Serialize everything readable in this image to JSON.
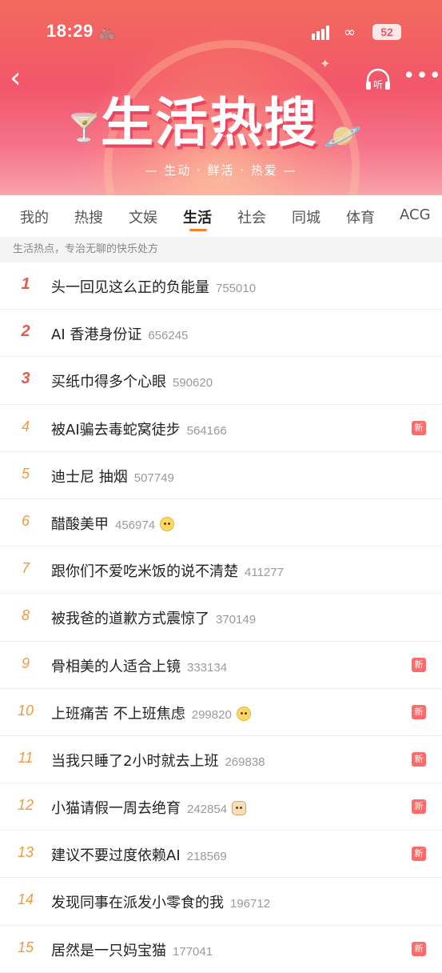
{
  "status_bar": {
    "time": "18:29",
    "battery": "52"
  },
  "header": {
    "title": "生活热搜",
    "subtitle": "— 生动 · 鲜活 · 热爱 —",
    "listen_label": "听"
  },
  "tabs": [
    "我的",
    "热搜",
    "文娱",
    "生活",
    "社会",
    "同城",
    "体育",
    "ACG"
  ],
  "active_tab": "生活",
  "notice": "生活热点，专治无聊的快乐处方",
  "badge_label": "新",
  "colors": {
    "accent": "#ff7a2b",
    "top_rank": "#e45a4f",
    "rank": "#f09a3d",
    "new_badge": "#ff6b6b"
  },
  "items": [
    {
      "rank": "1",
      "title": "头一回见这么正的负能量",
      "count": "755010",
      "icon": "",
      "new": false
    },
    {
      "rank": "2",
      "title": "AI 香港身份证",
      "count": "656245",
      "icon": "",
      "new": false
    },
    {
      "rank": "3",
      "title": "买纸巾得多个心眼",
      "count": "590620",
      "icon": "",
      "new": false
    },
    {
      "rank": "4",
      "title": "被AI骗去毒蛇窝徒步",
      "count": "564166",
      "icon": "",
      "new": true
    },
    {
      "rank": "5",
      "title": "迪士尼 抽烟",
      "count": "507749",
      "icon": "",
      "new": false
    },
    {
      "rank": "6",
      "title": "醋酸美甲",
      "count": "456974",
      "icon": "smiling-emoji-icon",
      "new": false
    },
    {
      "rank": "7",
      "title": "跟你们不爱吃米饭的说不清楚",
      "count": "411277",
      "icon": "",
      "new": false
    },
    {
      "rank": "8",
      "title": "被我爸的道歉方式震惊了",
      "count": "370149",
      "icon": "",
      "new": false
    },
    {
      "rank": "9",
      "title": "骨相美的人适合上镜",
      "count": "333134",
      "icon": "",
      "new": true
    },
    {
      "rank": "10",
      "title": "上班痛苦 不上班焦虑",
      "count": "299820",
      "icon": "face-emoji-icon",
      "new": true
    },
    {
      "rank": "11",
      "title": "当我只睡了2小时就去上班",
      "count": "269838",
      "icon": "",
      "new": true
    },
    {
      "rank": "12",
      "title": "小猫请假一周去绝育",
      "count": "242854",
      "icon": "cat-emoji-icon",
      "new": true
    },
    {
      "rank": "13",
      "title": "建议不要过度依赖AI",
      "count": "218569",
      "icon": "",
      "new": true
    },
    {
      "rank": "14",
      "title": "发现同事在派发小零食的我",
      "count": "196712",
      "icon": "",
      "new": false
    },
    {
      "rank": "15",
      "title": "居然是一只妈宝猫",
      "count": "177041",
      "icon": "",
      "new": true
    }
  ]
}
